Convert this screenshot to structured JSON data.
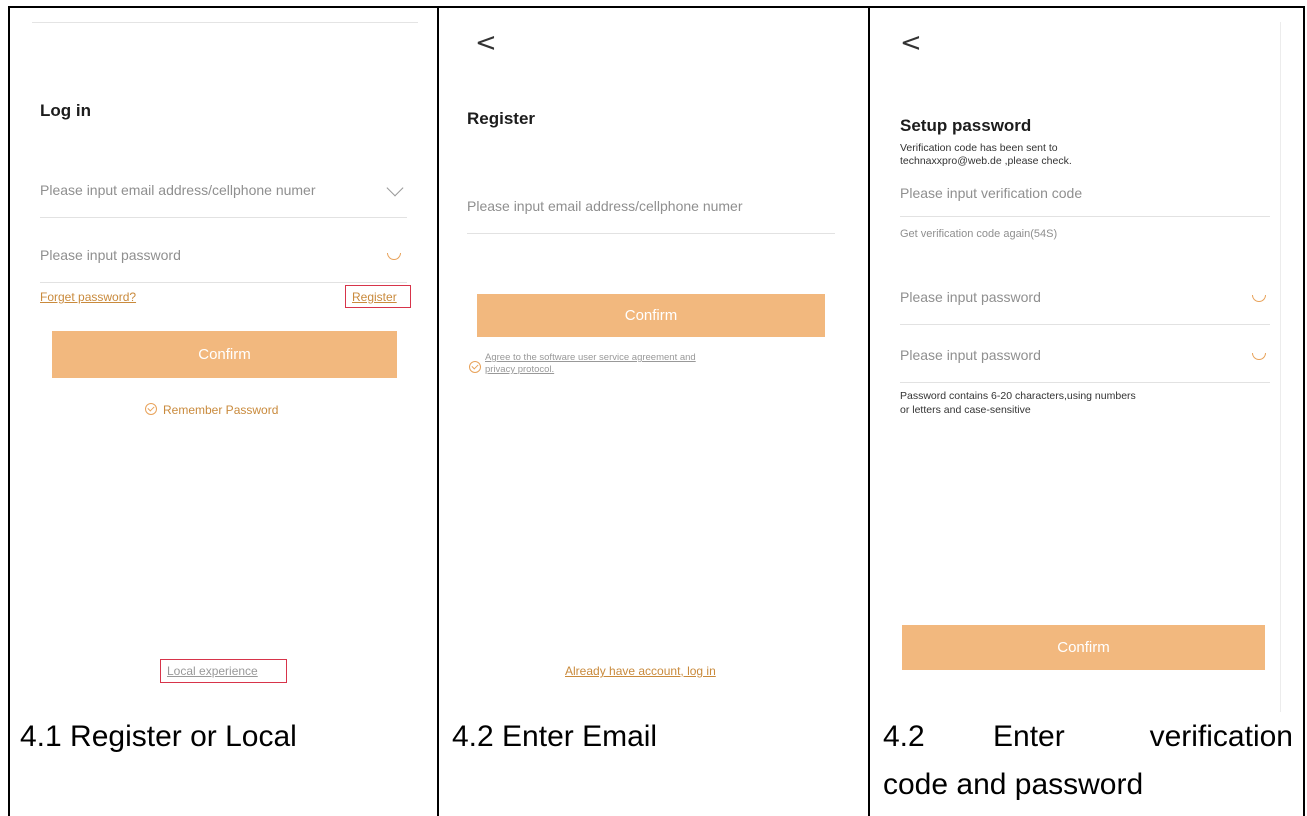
{
  "panels": {
    "login": {
      "title": "Log in",
      "email_placeholder": "Please input email address/cellphone numer",
      "password_placeholder": "Please input password",
      "forget_password": "Forget password?",
      "register_link": "Register",
      "confirm": "Confirm",
      "remember_password": "Remember Password",
      "local_experience": "Local experience"
    },
    "register": {
      "back": "<",
      "title": "Register",
      "email_placeholder": "Please input email address/cellphone numer",
      "confirm": "Confirm",
      "agreement_line1": "Agree to the software user service agreement and",
      "agreement_line2": "privacy protocol.",
      "login_link": "Already have account, log in"
    },
    "setup_password": {
      "back": "<",
      "title": "Setup password",
      "info_line1": "Verification code has been sent to",
      "info_line2": "technaxxpro@web.de ,please check.",
      "code_placeholder": "Please input verification code",
      "resend": "Get verification code again(54S)",
      "password_placeholder": "Please input password",
      "password_confirm_placeholder": "Please input password",
      "hint_line1": "Password contains 6-20 characters,using numbers",
      "hint_line2": "or letters and case-sensitive",
      "confirm": "Confirm"
    }
  },
  "captions": {
    "first": "4.1 Register or Local",
    "second": "4.2 Enter Email",
    "third_line1_num": "4.2",
    "third_line1_a": "Enter",
    "third_line1_b": "verification",
    "third_line2": "code and password"
  },
  "colors": {
    "accent": "#f2b87e",
    "link": "#c98a3c",
    "highlight": "#d7344a"
  }
}
